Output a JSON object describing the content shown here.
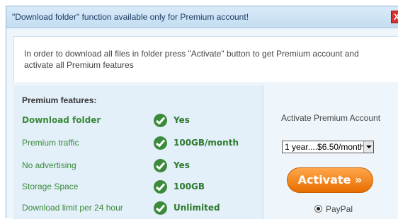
{
  "dialog": {
    "title": "\"Download folder\" function available only for Premium account!",
    "close_label": "X"
  },
  "intro": {
    "text": "In order to download all files in folder press \"Activate\" button to get Premium account and activate all Premium features"
  },
  "features": {
    "heading": "Premium features:",
    "items": [
      {
        "label": "Download folder",
        "value": "Yes"
      },
      {
        "label": "Premium traffic",
        "value": "100GB/month"
      },
      {
        "label": "No advertising",
        "value": "Yes"
      },
      {
        "label": "Storage Space",
        "value": "100GB"
      },
      {
        "label": "Download limit per 24 hour",
        "value": "Unlimited"
      }
    ]
  },
  "purchase": {
    "title": "Activate Premium Account",
    "plan_selected": "1 year....$6.50/month",
    "activate_label": "Activate »",
    "payment_method": "PayPal"
  },
  "colors": {
    "title_bar": "#c4dcf1",
    "feature_text": "#3a8a3a",
    "check_green": "#3c8b3c",
    "activate_orange": "#f07f10"
  }
}
